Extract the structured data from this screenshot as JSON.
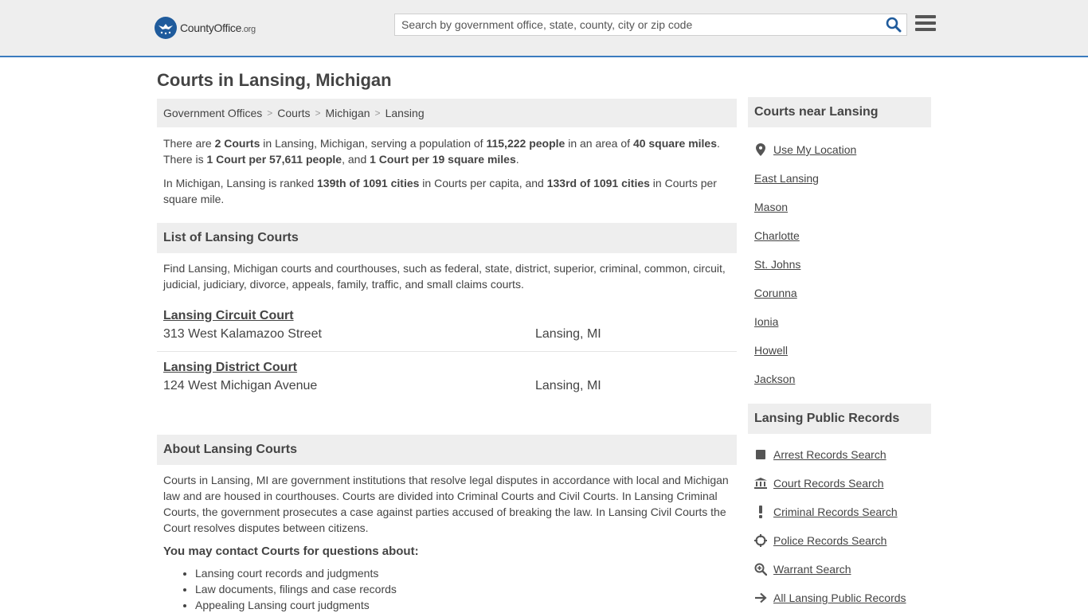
{
  "header": {
    "logo_main": "CountyOffice",
    "logo_tld": ".org",
    "search_placeholder": "Search by government office, state, county, city or zip code"
  },
  "page": {
    "title": "Courts in Lansing, Michigan"
  },
  "breadcrumb": [
    "Government Offices",
    "Courts",
    "Michigan",
    "Lansing"
  ],
  "summary": {
    "p1": [
      {
        "t": "There are ",
        "b": false
      },
      {
        "t": "2 Courts",
        "b": true
      },
      {
        "t": " in Lansing, Michigan, serving a population of ",
        "b": false
      },
      {
        "t": "115,222 people",
        "b": true
      },
      {
        "t": " in an area of ",
        "b": false
      },
      {
        "t": "40 square miles",
        "b": true
      },
      {
        "t": ". There is ",
        "b": false
      },
      {
        "t": "1 Court per 57,611 people",
        "b": true
      },
      {
        "t": ", and ",
        "b": false
      },
      {
        "t": "1 Court per 19 square miles",
        "b": true
      },
      {
        "t": ".",
        "b": false
      }
    ],
    "p2": [
      {
        "t": "In Michigan, Lansing is ranked ",
        "b": false
      },
      {
        "t": "139th of 1091 cities",
        "b": true
      },
      {
        "t": " in Courts per capita, and ",
        "b": false
      },
      {
        "t": "133rd of 1091 cities",
        "b": true
      },
      {
        "t": " in Courts per square mile.",
        "b": false
      }
    ]
  },
  "list_section": {
    "heading": "List of Lansing Courts",
    "intro": "Find Lansing, Michigan courts and courthouses, such as federal, state, district, superior, criminal, common, circuit, judicial, judiciary, divorce, appeals, family, traffic, and small claims courts.",
    "courts": [
      {
        "name": "Lansing Circuit Court",
        "address": "313 West Kalamazoo Street",
        "city": "Lansing, MI"
      },
      {
        "name": "Lansing District Court",
        "address": "124 West Michigan Avenue",
        "city": "Lansing, MI"
      }
    ]
  },
  "about_section": {
    "heading": "About Lansing Courts",
    "text": "Courts in Lansing, MI are government institutions that resolve legal disputes in accordance with local and Michigan law and are housed in courthouses. Courts are divided into Criminal Courts and Civil Courts. In Lansing Criminal Courts, the government prosecutes a case against parties accused of breaking the law. In Lansing Civil Courts the Court resolves disputes between citizens.",
    "contact_heading": "You may contact Courts for questions about:",
    "topics": [
      "Lansing court records and judgments",
      "Law documents, filings and case records",
      "Appealing Lansing court judgments"
    ]
  },
  "sidebar": {
    "near_heading": "Courts near Lansing",
    "use_location": "Use My Location",
    "near_cities": [
      "East Lansing",
      "Mason",
      "Charlotte",
      "St. Johns",
      "Corunna",
      "Ionia",
      "Howell",
      "Jackson"
    ],
    "records_heading": "Lansing Public Records",
    "records": [
      {
        "label": "Arrest Records Search",
        "icon": "square-icon"
      },
      {
        "label": "Court Records Search",
        "icon": "courthouse-icon"
      },
      {
        "label": "Criminal Records Search",
        "icon": "exclamation-icon"
      },
      {
        "label": "Police Records Search",
        "icon": "crosshair-icon"
      },
      {
        "label": "Warrant Search",
        "icon": "magnifier-icon"
      },
      {
        "label": "All Lansing Public Records",
        "icon": "arrow-right-icon"
      }
    ]
  },
  "colors": {
    "header_bg": "#eeeeee",
    "header_accent": "#3b7bbf",
    "logo_blue": "#1f5b9c",
    "search_icon": "#1f5b9c",
    "text": "#444444",
    "section_bg": "#eeeeee"
  }
}
